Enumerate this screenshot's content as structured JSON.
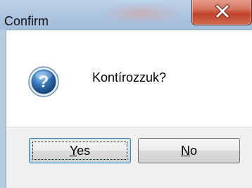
{
  "window": {
    "title": "Confirm"
  },
  "title_bar": {
    "close_icon": "close-icon"
  },
  "dialog": {
    "icon": "question-icon",
    "message": "Kontírozzuk?"
  },
  "buttons": {
    "yes": {
      "mnemonic": "Y",
      "rest": "es",
      "focused": true
    },
    "no": {
      "mnemonic": "N",
      "rest": "o",
      "focused": false
    }
  },
  "colors": {
    "title_bar": "#aec6df",
    "close_button": "#c0432c",
    "question_icon": "#2f6fb3"
  }
}
